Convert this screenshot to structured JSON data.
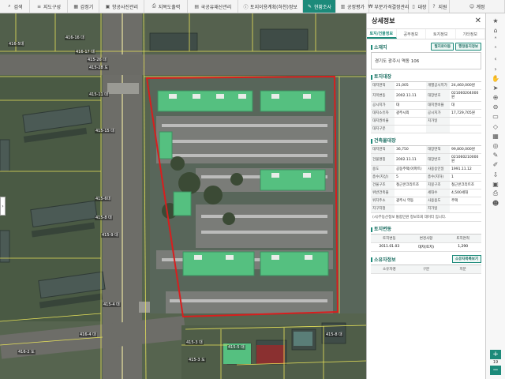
{
  "toolbar": {
    "items": [
      {
        "label": "검색",
        "icon": "search-icon"
      },
      {
        "label": "지도구성",
        "icon": "layers-icon"
      },
      {
        "label": "감정기",
        "icon": "calc-icon"
      },
      {
        "label": "항공사진관리",
        "icon": "photo-icon"
      },
      {
        "label": "지목도출력",
        "icon": "print-icon"
      },
      {
        "label": "국공유재산관리",
        "icon": "building-icon"
      },
      {
        "label": "토지이용계획(하천)정보",
        "icon": "info-icon"
      },
      {
        "label": "현황조사",
        "icon": "survey-icon"
      },
      {
        "label": "공정평가",
        "icon": "chart-icon"
      },
      {
        "label": "부분가격결정관리",
        "icon": "price-icon"
      },
      {
        "label": "대장",
        "icon": "book-icon"
      },
      {
        "label": "지원",
        "icon": "help-icon"
      },
      {
        "label": "계정",
        "icon": "user-icon"
      }
    ]
  },
  "map": {
    "labels": [
      "416-16 대",
      "416-5대",
      "416-17 대",
      "415-26 대",
      "415-28 도",
      "415-11 대",
      "415-15 대",
      "415-6대",
      "415-8 대",
      "415-9 대",
      "415-4 대",
      "416-4 대",
      "416-2 도",
      "415-3 대",
      "415-3 도",
      "415-5 대",
      "415-8 대"
    ]
  },
  "panel": {
    "title": "상세정보",
    "close": "✕",
    "tabs": [
      "토지/건물정보",
      "공부정보",
      "토지정보",
      "기타정보"
    ],
    "sections": {
      "location": {
        "title": "소재지",
        "btn1": "필지로이동",
        "btn2": "행정동지정보",
        "address": "경기도 광주시 역동 106"
      },
      "land": {
        "title": "토지대장",
        "rows": [
          [
            "대지면적",
            "21,005",
            "개별공시지가",
            "24,460,000원"
          ],
          [
            "지목변동",
            "2002.11.11",
            "대장번호",
            "021060204000원"
          ],
          [
            "공시지가",
            "대",
            "대지권비율",
            "대"
          ],
          [
            "대지소유자",
            "광주시외",
            "공시지가",
            "17,729,705원"
          ],
          [
            "대지권비율",
            "",
            "지가일",
            ""
          ],
          [
            "대지구분",
            "",
            "",
            ""
          ]
        ]
      },
      "building": {
        "title": "건축물대장",
        "rows": [
          [
            "대지면적",
            "36,750",
            "대장면적",
            "99,800,000원"
          ],
          [
            "건물명칭",
            "2002.11.11",
            "대장번호",
            "021060210000원"
          ],
          [
            "용도",
            "공동주택(아파트)",
            "사용승인일",
            "1991.11.12"
          ],
          [
            "층수(지상)",
            "5",
            "층수(지하)",
            "1"
          ],
          [
            "건물구조",
            "철근콘크리트조",
            "지붕구조",
            "철근콘크리트조"
          ],
          [
            "위반건축물",
            "",
            "세대수",
            "4,500세대"
          ],
          [
            "위치주소",
            "광주시 역동",
            "사용용도",
            "주택"
          ],
          [
            "지구지정",
            "",
            "지가일",
            ""
          ]
        ],
        "note": "(시)부동산정보 통합민원 정보조회 데이터 입니다."
      },
      "history": {
        "title": "토지변동",
        "headers": [
          "토지변동",
          "변경사항",
          "토지면적"
        ],
        "row": [
          "2011.01.03",
          "대지(토지)",
          "1,290"
        ]
      },
      "owners": {
        "title": "소유자정보",
        "btn": "소유자목록보기",
        "headers": [
          "소유자명",
          "구분",
          "지분"
        ]
      }
    }
  },
  "rail": {
    "icons": [
      "star-icon",
      "home-icon",
      "chevron-up-icon",
      "chevron-up-icon",
      "chevron-left-icon",
      "chevron-right-icon",
      "hand-icon",
      "cursor-icon",
      "zoom-in-icon",
      "zoom-out-icon",
      "ruler-icon",
      "area-icon",
      "grid-icon",
      "compass-icon",
      "edit-icon",
      "pen-icon",
      "download-icon",
      "save-icon",
      "print-icon",
      "people-icon"
    ],
    "zoom_in": "+",
    "zoom_out": "−",
    "zoom_level": "19"
  }
}
